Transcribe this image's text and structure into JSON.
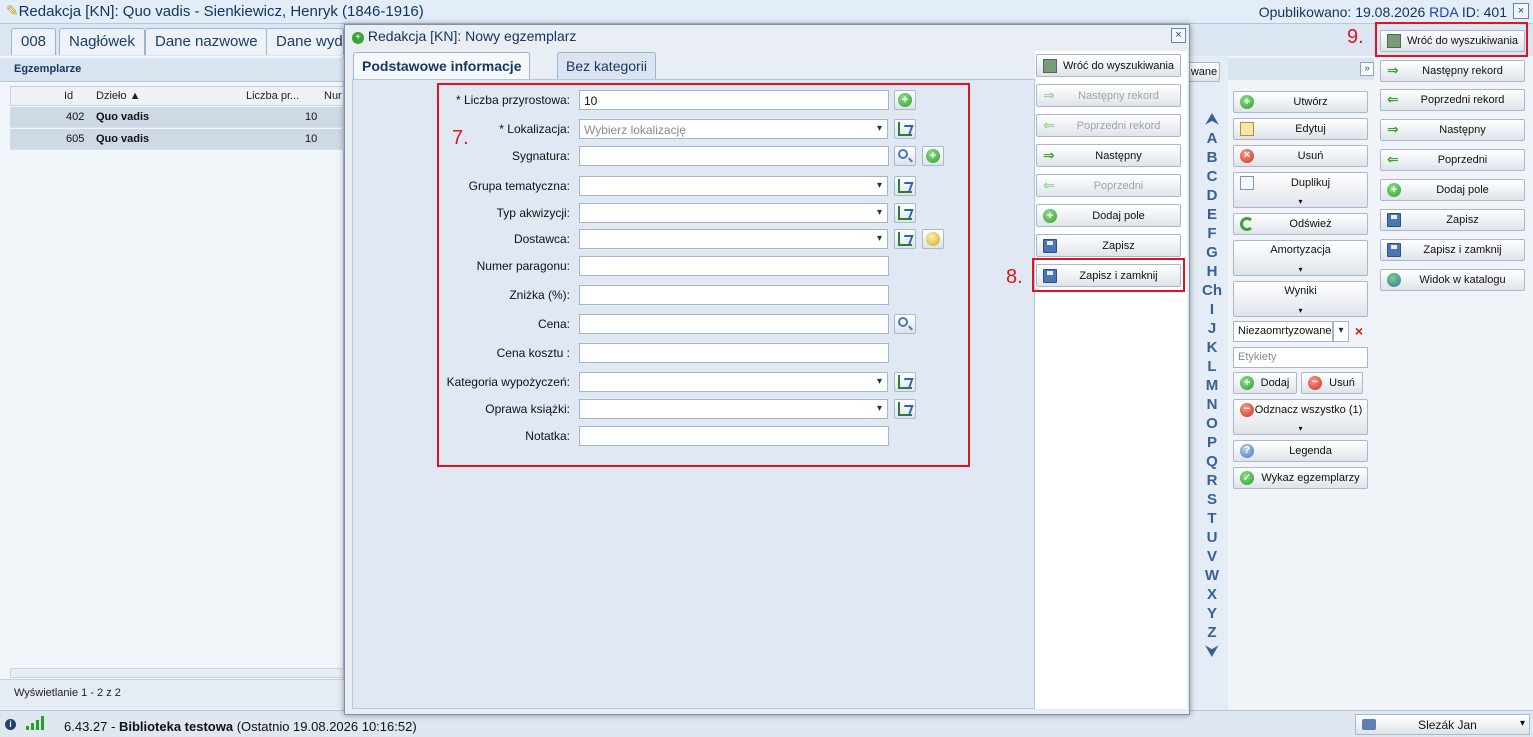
{
  "window": {
    "title": "Redakcja [KN]: Quo vadis - Sienkiewicz, Henryk (1846-1916)",
    "published_prefix": "Opublikowano: 19.08.2026 ",
    "rda": "RDA",
    "id_text": " ID: 401",
    "close": "×"
  },
  "bg_tabs": [
    "008",
    "Nagłówek",
    "Dane nazwowe",
    "Dane wyd"
  ],
  "left_panel": {
    "title": "Egzemplarze",
    "columns": [
      "Id",
      "Dzieło ▲",
      "Liczba pr...",
      "Nur"
    ],
    "rows": [
      {
        "id": "402",
        "title": "Quo vadis",
        "count": "10"
      },
      {
        "id": "605",
        "title": "Quo vadis",
        "count": "10"
      }
    ],
    "footer": "Wyświetlanie 1 - 2 z 2"
  },
  "letters": [
    "⮝",
    "A",
    "B",
    "C",
    "D",
    "E",
    "F",
    "G",
    "H",
    "Ch",
    "I",
    "J",
    "K",
    "L",
    "M",
    "N",
    "O",
    "P",
    "Q",
    "R",
    "S",
    "T",
    "U",
    "V",
    "W",
    "X",
    "Y",
    "Z",
    "⮟"
  ],
  "middle_panel": {
    "partial_label": "wane",
    "expand": "»",
    "buttons": {
      "create": "Utwórz",
      "edit": "Edytuj",
      "delete": "Usuń",
      "duplicate": "Duplikuj",
      "refresh": "Odśwież",
      "amortization": "Amortyzacja",
      "results": "Wyniki",
      "add": "Dodaj",
      "remove": "Usuń",
      "deselect_all": "Odznacz wszystko (1)",
      "legend": "Legenda",
      "list": "Wykaz egzemplarzy"
    },
    "amort_select_value": "Niezaomrtyzowane",
    "labels_placeholder": "Etykiety",
    "caret": "▾"
  },
  "right_panel": {
    "back": "Wróć do wyszukiwania",
    "next_record": "Następny rekord",
    "prev_record": "Poprzedni rekord",
    "next": "Następny",
    "prev": "Poprzedni",
    "add_field": "Dodaj pole",
    "save": "Zapisz",
    "save_close": "Zapisz i zamknij",
    "catalog_view": "Widok w katalogu"
  },
  "modal": {
    "title": "Redakcja [KN]: Nowy egzemplarz",
    "close": "×",
    "tabs": [
      "Podstawowe informacje",
      "Bez kategorii"
    ],
    "fields": {
      "increment_number": {
        "label": "* Liczba przyrostowa:",
        "value": "10"
      },
      "location": {
        "label": "* Lokalizacja:",
        "placeholder": "Wybierz lokalizację"
      },
      "signature": {
        "label": "Sygnatura:"
      },
      "subject_group": {
        "label": "Grupa tematyczna:"
      },
      "acquisition_type": {
        "label": "Typ akwizycji:"
      },
      "supplier": {
        "label": "Dostawca:"
      },
      "receipt_number": {
        "label": "Numer paragonu:"
      },
      "discount": {
        "label": "Zniżka (%):"
      },
      "price": {
        "label": "Cena:"
      },
      "cost_price": {
        "label": "Cena kosztu :"
      },
      "loan_category": {
        "label": "Kategoria wypożyczeń:"
      },
      "binding": {
        "label": "Oprawa książki:"
      },
      "note": {
        "label": "Notatka:"
      }
    },
    "dropdown_arrow": "▾",
    "plus": "+",
    "buttons": {
      "back": "Wróć do wyszukiwania",
      "next_record": "Następny rekord",
      "prev_record": "Poprzedni rekord",
      "next": "Następny",
      "prev": "Poprzedni",
      "add_field": "Dodaj pole",
      "save": "Zapisz",
      "save_close": "Zapisz i zamknij"
    }
  },
  "annotations": {
    "a7": "7.",
    "a8": "8.",
    "a9": "9."
  },
  "status": {
    "version": "6.43.27",
    "sep": " - ",
    "library": "Biblioteka testowa",
    "last": " (Ostatnio 19.08.2026 10:16:52)",
    "user": "Slezák Jan",
    "user_caret": "▾"
  },
  "colors": {
    "accent": "#e0141e",
    "title_blue": "#12335e",
    "rda_blue": "#1a3cc8"
  }
}
